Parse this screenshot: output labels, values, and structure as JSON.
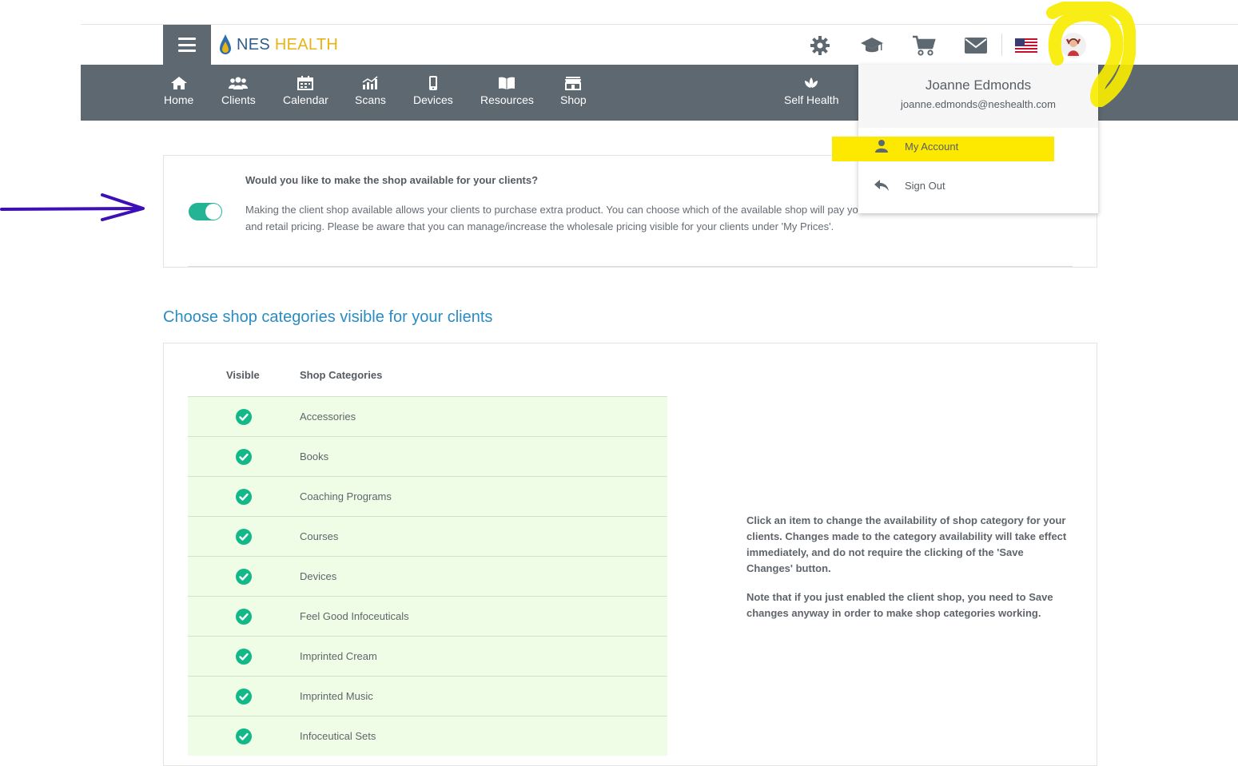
{
  "header": {
    "logo_nes": "NES",
    "logo_health": "HEALTH"
  },
  "nav": {
    "items": [
      {
        "label": "Home",
        "icon": "home-icon"
      },
      {
        "label": "Clients",
        "icon": "clients-icon"
      },
      {
        "label": "Calendar",
        "icon": "calendar-icon"
      },
      {
        "label": "Scans",
        "icon": "scans-icon"
      },
      {
        "label": "Devices",
        "icon": "device-icon"
      },
      {
        "label": "Resources",
        "icon": "book-icon"
      },
      {
        "label": "Shop",
        "icon": "shop-icon"
      }
    ],
    "self_health": "Self Health"
  },
  "user_menu": {
    "name": "Joanne Edmonds",
    "email": "joanne.edmonds@neshealth.com",
    "my_account": "My Account",
    "sign_out": "Sign Out"
  },
  "shop_toggle": {
    "title": "Would you like to make the shop available for your clients?",
    "text": "Making the client shop available allows your clients to purchase extra product. You can choose which of the available shop will pay you out the difference between wholesale and retail pricing. Please be aware that you can manage/increase the wholesale pricing visible for your clients under 'My Prices'.",
    "enabled": true
  },
  "categories": {
    "section_title": "Choose shop categories visible for your clients",
    "col_visible": "Visible",
    "col_categories": "Shop Categories",
    "rows": [
      "Accessories",
      "Books",
      "Coaching Programs",
      "Courses",
      "Devices",
      "Feel Good Infoceuticals",
      "Imprinted Cream",
      "Imprinted Music",
      "Infoceutical Sets"
    ],
    "note1": "Click an item to change the availability of shop category for your clients. Changes made to the category availability will take effect immediately, and do not require the clicking of the 'Save Changes' button.",
    "note2": "Note that if you just enabled the client shop, you need to Save changes anyway in order to make shop categories working."
  },
  "colors": {
    "nav_bg": "#5e6870",
    "toggle_on": "#22b495",
    "section_title": "#2a8cc2",
    "row_bg": "#effde7",
    "highlight": "#fde800",
    "annotation_arrow": "#3d0fb5"
  }
}
